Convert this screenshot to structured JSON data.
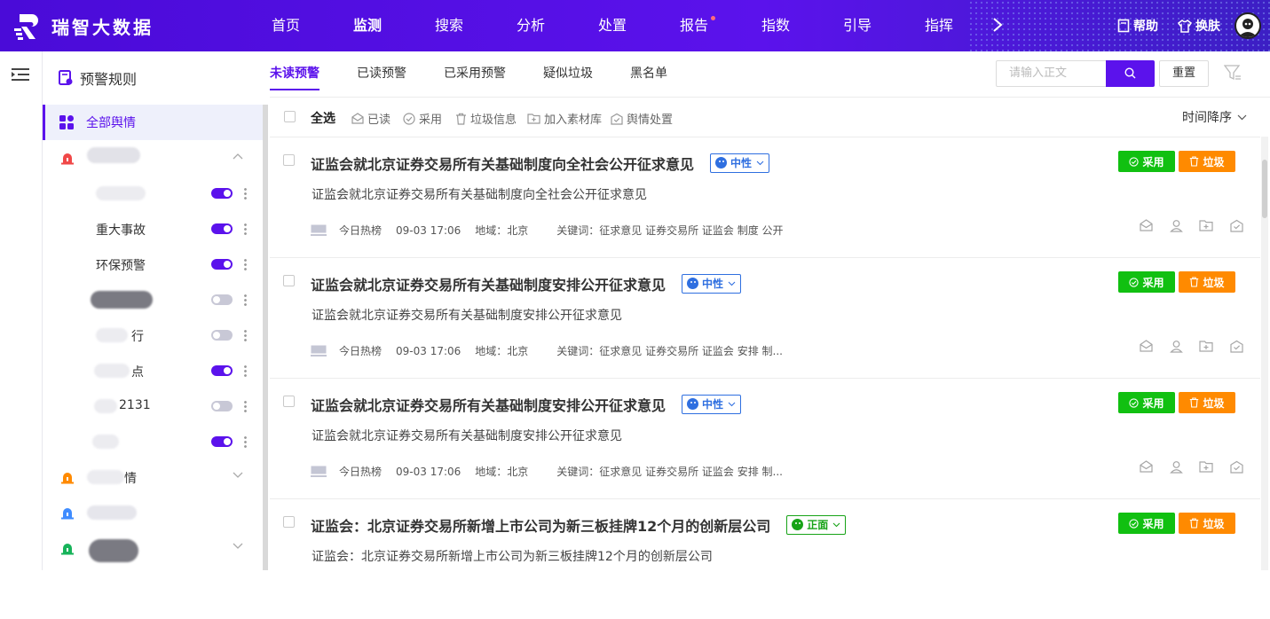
{
  "brand": {
    "name": "瑞智大数据"
  },
  "nav": {
    "items": [
      {
        "label": "首页",
        "active": false
      },
      {
        "label": "监测",
        "active": true
      },
      {
        "label": "搜索",
        "active": false
      },
      {
        "label": "分析",
        "active": false
      },
      {
        "label": "处置",
        "active": false
      },
      {
        "label": "报告",
        "active": false,
        "dot": true
      },
      {
        "label": "指数",
        "active": false
      },
      {
        "label": "引导",
        "active": false
      },
      {
        "label": "指挥",
        "active": false
      }
    ],
    "more_icon": "chevron-right-icon"
  },
  "top_tools": {
    "help_label": "帮助",
    "skin_label": "换肤"
  },
  "sidebar": {
    "title": "预警规则",
    "all_label": "全部舆情",
    "items": [
      {
        "label": "重大事故",
        "enabled": true
      },
      {
        "label": "环保预警",
        "enabled": true
      }
    ],
    "partial_text": {
      "item_8131": "2131",
      "item_row6_tail": "点",
      "item_row5_tail": "行",
      "group2_tail": "情"
    }
  },
  "tabs": [
    {
      "label": "未读预警",
      "active": true
    },
    {
      "label": "已读预警",
      "active": false
    },
    {
      "label": "已采用预警",
      "active": false
    },
    {
      "label": "疑似垃圾",
      "active": false
    },
    {
      "label": "黑名单",
      "active": false
    }
  ],
  "search": {
    "placeholder": "请输入正文",
    "reset_label": "重置"
  },
  "toolbar": {
    "select_all": "全选",
    "actions": [
      "已读",
      "采用",
      "垃圾信息",
      "加入素材库",
      "舆情处置"
    ],
    "sort_label": "时间降序"
  },
  "articles": [
    {
      "title": "证监会就北京证券交易所有关基础制度向全社会公开征求意见",
      "sentiment": "中性",
      "summary": "证监会就北京证券交易所有关基础制度向全社会公开征求意见",
      "source": "今日热榜",
      "time": "09-03 17:06",
      "region": "地域：北京",
      "keywords": "关键词：征求意见 证券交易所 证监会 制度 公开"
    },
    {
      "title": "证监会就北京证券交易所有关基础制度安排公开征求意见",
      "sentiment": "中性",
      "summary": "证监会就北京证券交易所有关基础制度安排公开征求意见",
      "source": "今日热榜",
      "time": "09-03 17:06",
      "region": "地域：北京",
      "keywords": "关键词：征求意见 证券交易所 证监会 安排 制..."
    },
    {
      "title": "证监会就北京证券交易所有关基础制度安排公开征求意见",
      "sentiment": "中性",
      "summary": "证监会就北京证券交易所有关基础制度安排公开征求意见",
      "source": "今日热榜",
      "time": "09-03 17:06",
      "region": "地域：北京",
      "keywords": "关键词：征求意见 证券交易所 证监会 安排 制..."
    },
    {
      "title": "证监会：北京证券交易所新增上市公司为新三板挂牌12个月的创新层公司",
      "sentiment": "正面",
      "summary": "证监会：北京证券交易所新增上市公司为新三板挂牌12个月的创新层公司",
      "source": "",
      "time": "",
      "region": "",
      "keywords": ""
    }
  ],
  "card_buttons": {
    "adopt": "采用",
    "trash": "垃圾"
  },
  "colors": {
    "brand": "#5b12ec",
    "adopt": "#11c011",
    "trash": "#ff8a00",
    "neutral": "#2f6fe0",
    "positive": "#17a317"
  }
}
